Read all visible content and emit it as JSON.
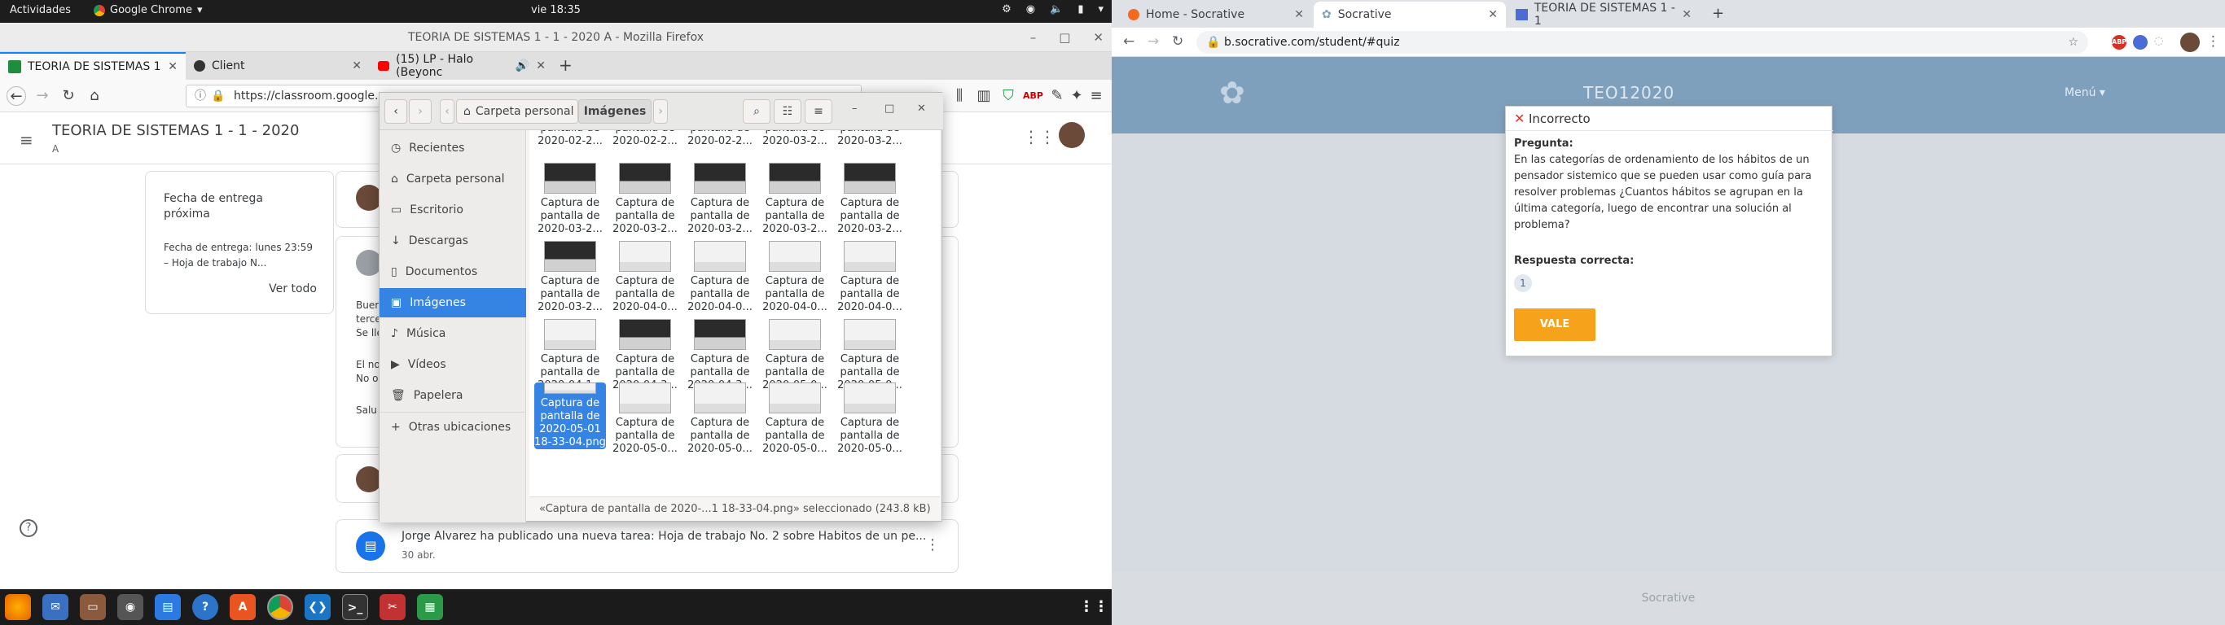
{
  "topbar": {
    "activities": "Actividades",
    "app": "Google Chrome",
    "clock": "vie 18:35"
  },
  "firefox": {
    "window_title": "TEORIA DE SISTEMAS 1 - 1 - 2020 A - Mozilla Firefox",
    "tabs": [
      {
        "label": "TEORIA DE SISTEMAS 1"
      },
      {
        "label": "Client"
      },
      {
        "label": "(15) LP - Halo (Beyonc"
      }
    ],
    "url": "https://classroom.google.c",
    "classroom": {
      "course_title": "TEORIA DE SISTEMAS 1 - 1 - 2020",
      "course_section": "A",
      "due_card": {
        "heading": "Fecha de entrega próxima",
        "detail": "Fecha de entrega: lunes 23:59 – Hoja de trabajo N...",
        "link": "Ver todo"
      },
      "snippets": [
        "Buer",
        "terce",
        "Se lle",
        "El no",
        "No o",
        "Salu"
      ],
      "post": {
        "text": "Jorge Alvarez ha publicado una nueva tarea: Hoja de trabajo No. 2 sobre Habitos de un pe...",
        "date": "30 abr."
      }
    }
  },
  "file_manager": {
    "path": [
      "Carpeta personal",
      "Imágenes"
    ],
    "sidebar": [
      {
        "label": "Recientes",
        "icon": "clock-icon"
      },
      {
        "label": "Carpeta personal",
        "icon": "home-icon"
      },
      {
        "label": "Escritorio",
        "icon": "folder-icon"
      },
      {
        "label": "Descargas",
        "icon": "download-icon"
      },
      {
        "label": "Documentos",
        "icon": "document-icon"
      },
      {
        "label": "Imágenes",
        "icon": "image-icon",
        "selected": true
      },
      {
        "label": "Música",
        "icon": "music-icon"
      },
      {
        "label": "Vídeos",
        "icon": "video-icon"
      },
      {
        "label": "Papelera",
        "icon": "trash-icon"
      },
      {
        "label": "Otras ubicaciones",
        "icon": "plus-icon"
      }
    ],
    "files": [
      {
        "name": "pantalla de 2020-02-2...",
        "thumb": "light",
        "partial": true
      },
      {
        "name": "pantalla de 2020-02-2...",
        "thumb": "light",
        "partial": true
      },
      {
        "name": "pantalla de 2020-02-2...",
        "thumb": "light",
        "partial": true
      },
      {
        "name": "pantalla de 2020-03-2...",
        "thumb": "light",
        "partial": true
      },
      {
        "name": "pantalla de 2020-03-2...",
        "thumb": "light",
        "partial": true
      },
      {
        "name": "Captura de pantalla de 2020-03-2...",
        "thumb": "dark"
      },
      {
        "name": "Captura de pantalla de 2020-03-2...",
        "thumb": "dark"
      },
      {
        "name": "Captura de pantalla de 2020-03-2...",
        "thumb": "dark"
      },
      {
        "name": "Captura de pantalla de 2020-03-2...",
        "thumb": "dark"
      },
      {
        "name": "Captura de pantalla de 2020-03-2...",
        "thumb": "dark"
      },
      {
        "name": "Captura de pantalla de 2020-03-2...",
        "thumb": "dark"
      },
      {
        "name": "Captura de pantalla de 2020-04-0...",
        "thumb": "light"
      },
      {
        "name": "Captura de pantalla de 2020-04-0...",
        "thumb": "light"
      },
      {
        "name": "Captura de pantalla de 2020-04-0...",
        "thumb": "light"
      },
      {
        "name": "Captura de pantalla de 2020-04-0...",
        "thumb": "light"
      },
      {
        "name": "Captura de pantalla de 2020-04-1...",
        "thumb": "light"
      },
      {
        "name": "Captura de pantalla de 2020-04-3...",
        "thumb": "dark"
      },
      {
        "name": "Captura de pantalla de 2020-04-3...",
        "thumb": "dark"
      },
      {
        "name": "Captura de pantalla de 2020-05-0...",
        "thumb": "light"
      },
      {
        "name": "Captura de pantalla de 2020-05-0...",
        "thumb": "light"
      },
      {
        "name": "Captura de pantalla de 2020-05-01 18-33-04.png",
        "thumb": "light",
        "selected": true
      },
      {
        "name": "Captura de pantalla de 2020-05-0...",
        "thumb": "light"
      },
      {
        "name": "Captura de pantalla de 2020-05-0...",
        "thumb": "light"
      },
      {
        "name": "Captura de pantalla de 2020-05-0...",
        "thumb": "light"
      },
      {
        "name": "Captura de pantalla de 2020-05-0...",
        "thumb": "light"
      }
    ],
    "status": "«Captura de pantalla de 2020-...1 18-33-04.png» seleccionado  (243.8 kB)"
  },
  "chrome": {
    "tabs": [
      {
        "label": "Home - Socrative"
      },
      {
        "label": "Socrative"
      },
      {
        "label": "TEORIA DE SISTEMAS 1 - 1"
      }
    ],
    "url": "b.socrative.com/student/#quiz",
    "socrative": {
      "room": "TEO12020",
      "menu": "Menú",
      "footer": "Socrative",
      "modal": {
        "title": "Incorrecto",
        "question_label": "Pregunta:",
        "question": "En las categorías de ordenamiento de los hábitos de un pensador sistemico que se pueden usar como guía para resolver problemas ¿Cuantos hábitos se agrupan en la última categoría, luego de encontrar una solución al problema?",
        "answer_label": "Respuesta correcta:",
        "answer": "1",
        "ok_button": "VALE"
      }
    }
  },
  "colors": {
    "accent_blue": "#3584e4",
    "socrative_orange": "#f7a21b",
    "incorrect_red": "#d9342b",
    "socrative_header": "#7fa0bd"
  }
}
